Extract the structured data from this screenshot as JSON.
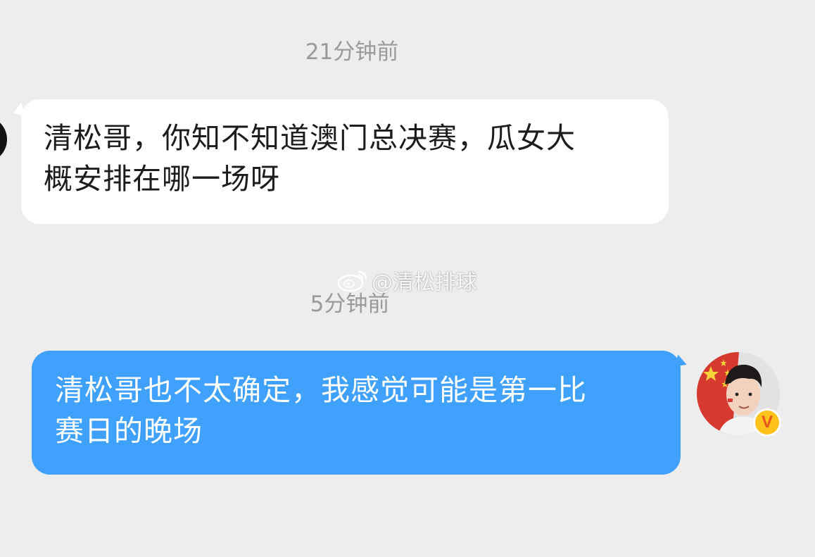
{
  "timestamps": {
    "first": "21分钟前",
    "second": "5分钟前"
  },
  "messages": [
    {
      "direction": "incoming",
      "lines": [
        "清松哥，你知不知道澳门总决赛，瓜女大",
        "概安排在哪一场呀"
      ]
    },
    {
      "direction": "outgoing",
      "lines": [
        "清松哥也不太确定，我感觉可能是第一比",
        "赛日的晚场"
      ]
    }
  ],
  "watermark": {
    "icon": "weibo-logo-icon",
    "text": "@清松排球"
  },
  "badges": {
    "verified_label": "V"
  },
  "colors": {
    "background": "#ededed",
    "incoming_bubble": "#ffffff",
    "outgoing_bubble": "#3fa1fb",
    "verified_badge": "#ffc21a"
  }
}
